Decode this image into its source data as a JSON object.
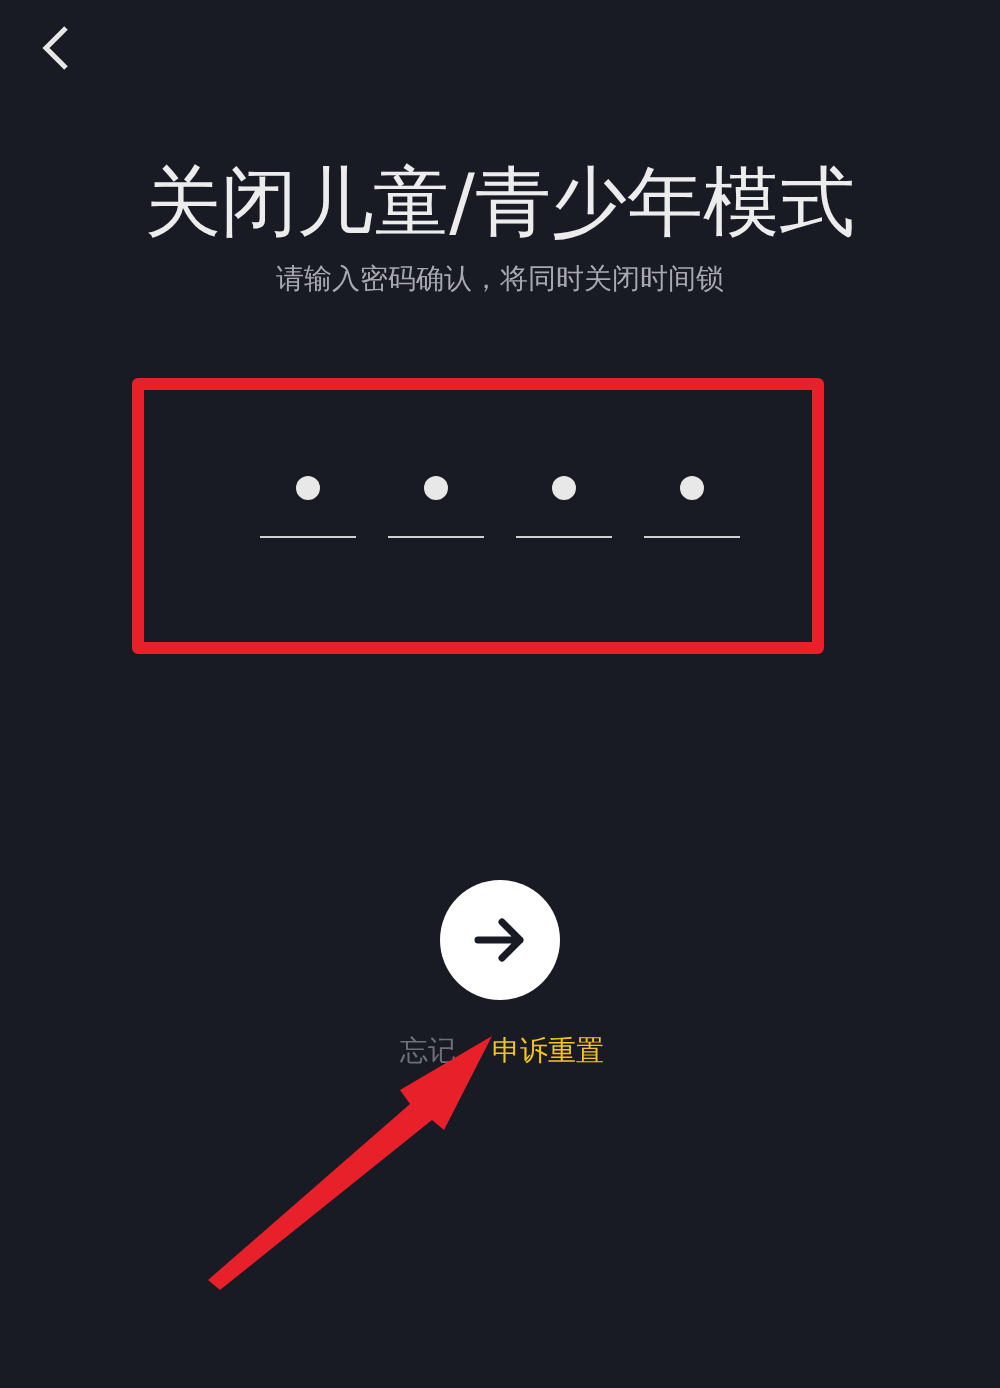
{
  "title": "关闭儿童/青少年模式",
  "subtitle": "请输入密码确认，将同时关闭时间锁",
  "pin_slots": [
    {
      "filled": true
    },
    {
      "filled": true
    },
    {
      "filled": true
    },
    {
      "filled": true
    }
  ],
  "footer": {
    "forgot_link": "忘记",
    "appeal_link": "申诉重置"
  },
  "annotations": {
    "highlight_box": true,
    "pointer_arrow": true
  }
}
